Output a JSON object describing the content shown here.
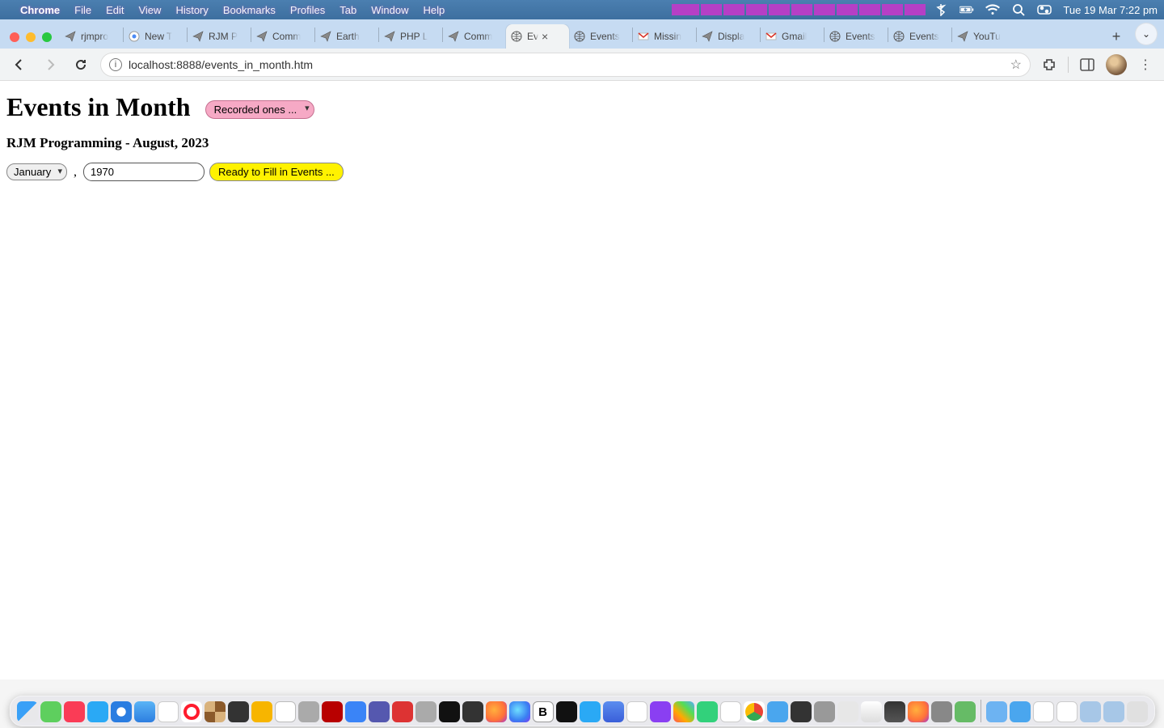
{
  "menubar": {
    "app_name": "Chrome",
    "items": [
      "File",
      "Edit",
      "View",
      "History",
      "Bookmarks",
      "Profiles",
      "Tab",
      "Window",
      "Help"
    ],
    "clock": "Tue 19 Mar  7:22 pm"
  },
  "tabs": [
    {
      "title": "rjmpro",
      "icon": "paperplane"
    },
    {
      "title": "New T",
      "icon": "chrome"
    },
    {
      "title": "RJM P",
      "icon": "paperplane"
    },
    {
      "title": "Comm",
      "icon": "paperplane"
    },
    {
      "title": "Earth",
      "icon": "paperplane"
    },
    {
      "title": "PHP L",
      "icon": "paperplane"
    },
    {
      "title": "Comm",
      "icon": "paperplane"
    },
    {
      "title": "Ev",
      "icon": "globe",
      "active": true
    },
    {
      "title": "Events",
      "icon": "globe"
    },
    {
      "title": "Missin",
      "icon": "gmail"
    },
    {
      "title": "Displa",
      "icon": "paperplane"
    },
    {
      "title": "Gmail",
      "icon": "gmail"
    },
    {
      "title": "Events",
      "icon": "globe"
    },
    {
      "title": "Events",
      "icon": "globe"
    },
    {
      "title": "YouTu",
      "icon": "paperplane"
    }
  ],
  "omnibox": {
    "url": "localhost:8888/events_in_month.htm"
  },
  "page": {
    "h1": "Events in Month",
    "recorded": "Recorded ones ...",
    "subtitle": "RJM Programming - August, 2023",
    "month": "January",
    "comma": ",",
    "year": "1970",
    "ready_btn": "Ready to Fill in Events ..."
  }
}
